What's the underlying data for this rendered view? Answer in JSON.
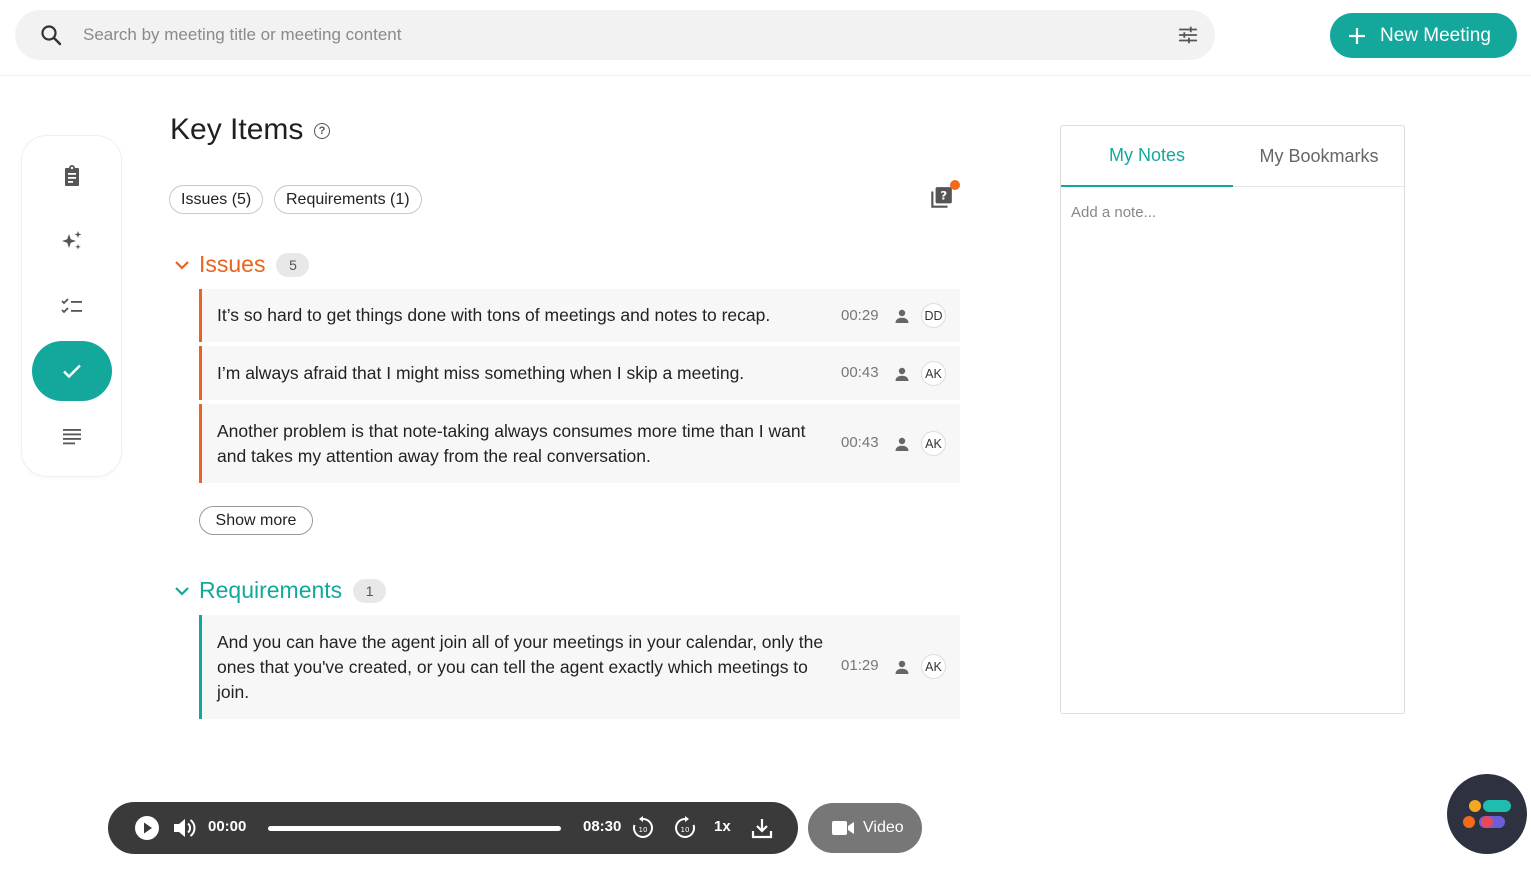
{
  "search": {
    "placeholder": "Search by meeting title or meeting content",
    "value": ""
  },
  "header": {
    "new_meeting_label": "New Meeting"
  },
  "sidebar": {
    "items": [
      {
        "name": "summary",
        "icon": "clipboard-icon"
      },
      {
        "name": "ai",
        "icon": "sparkles-icon"
      },
      {
        "name": "action-items",
        "icon": "checklist-icon"
      },
      {
        "name": "key-items",
        "icon": "check-icon",
        "active": true
      },
      {
        "name": "transcript",
        "icon": "text-lines-icon"
      }
    ]
  },
  "main": {
    "title": "Key Items",
    "help_glyph": "?",
    "filters": [
      "Issues (5)",
      "Requirements (1)"
    ],
    "issues": {
      "label": "Issues",
      "count": "5",
      "color": "#e8641f",
      "items": [
        {
          "text": "It’s so hard to get things done with tons of meetings and notes to recap.",
          "time": "00:29",
          "speaker": "DD"
        },
        {
          "text": "I’m always afraid that I might miss something when I skip a meeting.",
          "time": "00:43",
          "speaker": "AK"
        },
        {
          "text": "Another problem is that note-taking always consumes more time than I want and takes my attention away from the real conversation.",
          "time": "00:43",
          "speaker": "AK"
        }
      ],
      "show_more_label": "Show more"
    },
    "requirements": {
      "label": "Requirements",
      "count": "1",
      "color": "#14a89c",
      "items": [
        {
          "text": "And you can have the agent join all of your meetings in your calendar, only the ones that you've created, or you can tell the agent exactly which meetings to join.",
          "time": "01:29",
          "speaker": "AK"
        }
      ]
    }
  },
  "notes": {
    "tabs": [
      "My Notes",
      "My Bookmarks"
    ],
    "active_tab": "My Notes",
    "placeholder": "Add a note..."
  },
  "player": {
    "current_time": "00:00",
    "duration": "08:30",
    "speed": "1x",
    "progress": 0,
    "video_label": "Video"
  },
  "colors": {
    "accent": "#14a89c",
    "issue": "#e8641f",
    "player_bg": "#3a3a3a"
  }
}
